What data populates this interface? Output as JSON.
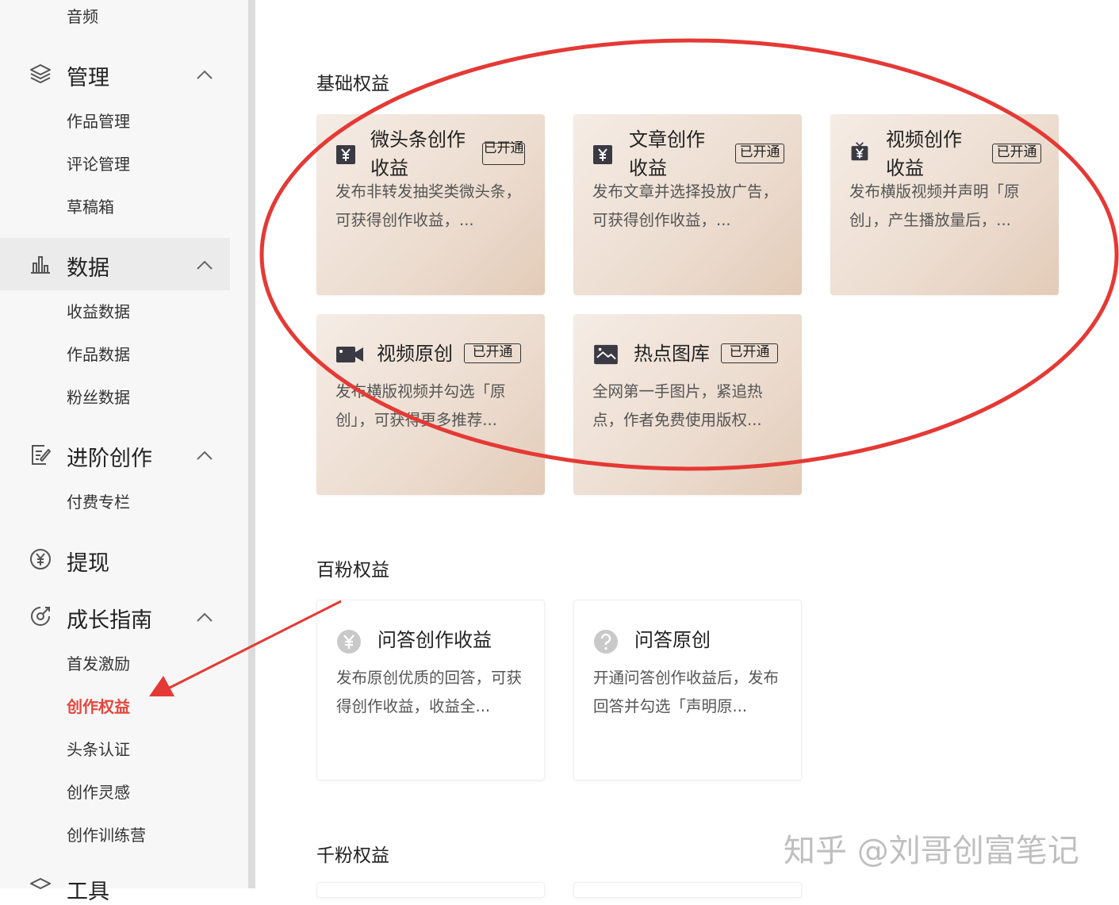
{
  "sidebar": {
    "top_item": "音频",
    "groups": [
      {
        "title": "管理",
        "icon": "layers-icon",
        "items": [
          "作品管理",
          "评论管理",
          "草稿箱"
        ]
      },
      {
        "title": "数据",
        "icon": "bar-chart-icon",
        "items": [
          "收益数据",
          "作品数据",
          "粉丝数据"
        ]
      },
      {
        "title": "进阶创作",
        "icon": "edit-doc-icon",
        "items": [
          "付费专栏"
        ]
      },
      {
        "title": "提现",
        "icon": "yuan-circle-icon",
        "items": []
      },
      {
        "title": "成长指南",
        "icon": "growth-icon",
        "items": [
          "首发激励",
          "创作权益",
          "头条认证",
          "创作灵感",
          "创作训练营"
        ]
      },
      {
        "title": "工具",
        "icon": "layers-icon",
        "items": []
      }
    ],
    "active_item": "创作权益"
  },
  "sections": [
    {
      "title": "基础权益",
      "cards": [
        {
          "title": "微头条创作收益",
          "badge": "已开通",
          "desc": "发布非转发抽奖类微头条，可获得创作收益，...",
          "icon": "yuan-badge-icon"
        },
        {
          "title": "文章创作收益",
          "badge": "已开通",
          "desc": "发布文章并选择投放广告，可获得创作收益，...",
          "icon": "yuan-badge-icon"
        },
        {
          "title": "视频创作收益",
          "badge": "已开通",
          "desc": "发布横版视频并声明「原创」，产生播放量后，...",
          "icon": "tv-yuan-icon"
        },
        {
          "title": "视频原创",
          "badge": "已开通",
          "desc": "发布横版视频并勾选「原创」，可获得更多推荐...",
          "icon": "video-camera-icon"
        },
        {
          "title": "热点图库",
          "badge": "已开通",
          "desc": "全网第一手图片，紧追热点，作者免费使用版权...",
          "icon": "image-icon"
        }
      ]
    },
    {
      "title": "百粉权益",
      "cards": [
        {
          "title": "问答创作收益",
          "desc": "发布原创优质的回答，可获得创作收益，收益全...",
          "icon": "yuan-circle-gray-icon"
        },
        {
          "title": "问答原创",
          "desc": "开通问答创作收益后，发布回答并勾选「声明原...",
          "icon": "question-circle-icon"
        }
      ]
    },
    {
      "title": "千粉权益",
      "cards": []
    }
  ],
  "watermark": "知乎 @刘哥创富笔记",
  "colors": {
    "accent": "#e8463c",
    "annotation": "#e53935",
    "premium_card": "#ecdccf"
  }
}
